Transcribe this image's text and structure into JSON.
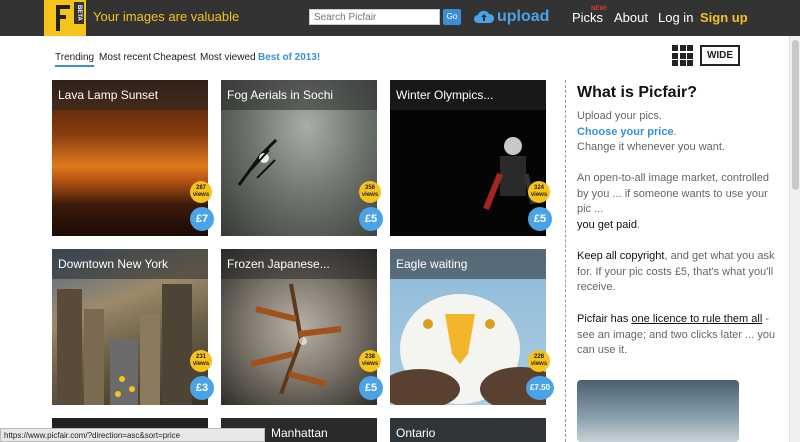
{
  "header": {
    "beta_label": "BETA",
    "tagline": "Your images are valuable",
    "search_placeholder": "Search Picfair",
    "go_label": "Go",
    "upload_label": "upload",
    "nav": {
      "picks": "Picks",
      "picks_badge": "NEW!",
      "about": "About",
      "login": "Log in",
      "signup": "Sign up"
    },
    "colors": {
      "bar": "#333333",
      "accent": "#f6c31a",
      "blue": "#3a8fd6"
    }
  },
  "filters": {
    "tabs": [
      "Trending",
      "Most recent",
      "Cheapest",
      "Most viewed",
      "Best of 2013!"
    ],
    "active": "Trending",
    "wide_label": "WIDE"
  },
  "cards": [
    {
      "title": "Lava Lamp Sunset",
      "views": "287",
      "views_label": "views",
      "price": "£7"
    },
    {
      "title": "Fog Aerials in Sochi",
      "views": "356",
      "views_label": "views",
      "price": "£5"
    },
    {
      "title": "Winter Olympics...",
      "views": "324",
      "views_label": "views",
      "price": "£5"
    },
    {
      "title": "Downtown New York",
      "views": "231",
      "views_label": "views",
      "price": "£3"
    },
    {
      "title": "Frozen Japanese...",
      "views": "238",
      "views_label": "views",
      "price": "£5"
    },
    {
      "title": "Eagle waiting",
      "views": "228",
      "views_label": "views",
      "price": "£7.50"
    },
    {
      "title": ""
    },
    {
      "title": "Manhattan"
    },
    {
      "title": "Ontario"
    }
  ],
  "sidebar": {
    "title": "What is Picfair?",
    "p1_line1": "Upload your pics.",
    "p1_link": "Choose your price",
    "p1_dot": ".",
    "p1_line3": "Change it whenever you want.",
    "p2_text": "An open-to-all image market, controlled by you ... if someone wants to use your pic ...",
    "p2_bold": "you get paid",
    "p2_end": ".",
    "p3_bold": "Keep all copyright",
    "p3_text": ", and get what you ask for. If your pic costs £5, that's what you'll receive.",
    "p4_start": "Picfair has ",
    "p4_link": "one licence to rule them all",
    "p4_text": " - see an image; and two clicks later ... you can use it."
  },
  "status_bar": "https://www.picfair.com/?direction=asc&sort=price"
}
